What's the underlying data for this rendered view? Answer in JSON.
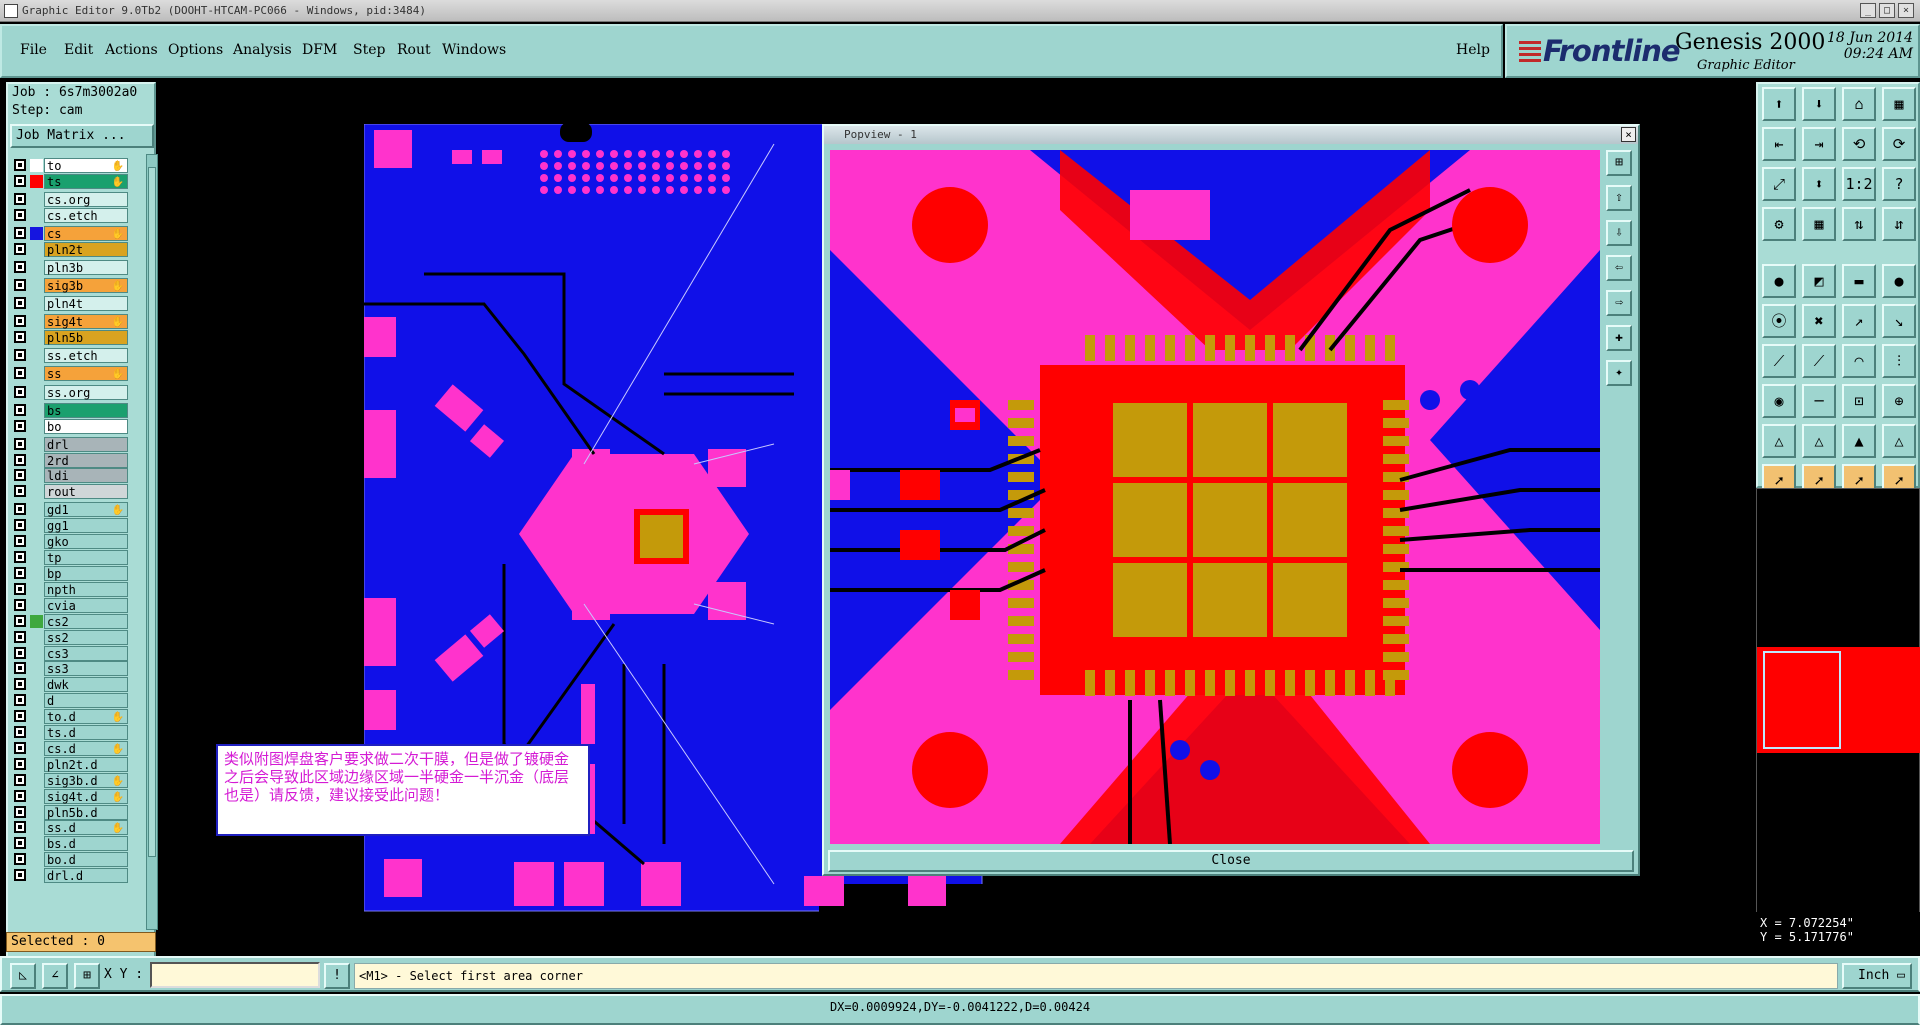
{
  "window": {
    "title": "Graphic Editor 9.0Tb2 (DOOHT-HTCAM-PC066 - Windows, pid:3484)"
  },
  "menu": {
    "items": [
      "File",
      "Edit",
      "Actions",
      "Options",
      "Analysis",
      "DFM",
      "Step",
      "Rout",
      "Windows"
    ],
    "help": "Help"
  },
  "brand": {
    "logo": "Frontline",
    "product": "Genesis 2000",
    "subtitle": "Graphic Editor",
    "date": "18 Jun 2014",
    "time": "09:24 AM"
  },
  "job": {
    "name": "Job : 6s7m3002a0",
    "step": "Step: cam",
    "matrix_button": "Job Matrix ..."
  },
  "layers": [
    {
      "name": "to",
      "bg": "#ffffff",
      "color": "#ffffff",
      "flag": "✋"
    },
    {
      "name": "ts",
      "bg": "#1aa06e",
      "color": "#ff0000",
      "flag": "✋"
    },
    {
      "name": "cs.org",
      "bg": "#d4f0ec",
      "color": ""
    },
    {
      "name": "cs.etch",
      "bg": "#d4f0ec",
      "color": ""
    },
    {
      "name": "cs",
      "bg": "#f5a23a",
      "color": "#1515e0",
      "flag": "✋"
    },
    {
      "name": "pln2t",
      "bg": "#d9a320",
      "color": ""
    },
    {
      "name": "pln3b",
      "bg": "#d4f0ec",
      "color": ""
    },
    {
      "name": "sig3b",
      "bg": "#f5a23a",
      "color": "",
      "flag": "✋"
    },
    {
      "name": "pln4t",
      "bg": "#d4f0ec",
      "color": ""
    },
    {
      "name": "sig4t",
      "bg": "#f5a23a",
      "color": "",
      "flag": "✋"
    },
    {
      "name": "pln5b",
      "bg": "#d9a320",
      "color": ""
    },
    {
      "name": "ss.etch",
      "bg": "#d4f0ec",
      "color": ""
    },
    {
      "name": "ss",
      "bg": "#f5a23a",
      "color": "",
      "flag": "✋"
    },
    {
      "name": "ss.org",
      "bg": "#d4f0ec",
      "color": ""
    },
    {
      "name": "bs",
      "bg": "#1aa06e",
      "color": ""
    },
    {
      "name": "bo",
      "bg": "#ffffff",
      "color": ""
    },
    {
      "name": "drl",
      "bg": "#a8b4b8",
      "color": ""
    },
    {
      "name": "2rd",
      "bg": "#a8b4b8",
      "color": ""
    },
    {
      "name": "ldi",
      "bg": "#a8b4b8",
      "color": ""
    },
    {
      "name": "rout",
      "bg": "#d0d6d8",
      "color": ""
    },
    {
      "name": "gd1",
      "bg": "#9ed5cf",
      "color": "",
      "flag": "✋"
    },
    {
      "name": "gg1",
      "bg": "#9ed5cf",
      "color": ""
    },
    {
      "name": "gko",
      "bg": "#9ed5cf",
      "color": ""
    },
    {
      "name": "tp",
      "bg": "#9ed5cf",
      "color": ""
    },
    {
      "name": "bp",
      "bg": "#9ed5cf",
      "color": ""
    },
    {
      "name": "npth",
      "bg": "#9ed5cf",
      "color": ""
    },
    {
      "name": "cvia",
      "bg": "#9ed5cf",
      "color": ""
    },
    {
      "name": "cs2",
      "bg": "#9ed5cf",
      "color": "#3ea83e"
    },
    {
      "name": "ss2",
      "bg": "#9ed5cf",
      "color": ""
    },
    {
      "name": "cs3",
      "bg": "#9ed5cf",
      "color": ""
    },
    {
      "name": "ss3",
      "bg": "#9ed5cf",
      "color": ""
    },
    {
      "name": "dwk",
      "bg": "#9ed5cf",
      "color": ""
    },
    {
      "name": "d",
      "bg": "#9ed5cf",
      "color": ""
    },
    {
      "name": "to.d",
      "bg": "#9ed5cf",
      "color": "",
      "flag": "✋"
    },
    {
      "name": "ts.d",
      "bg": "#9ed5cf",
      "color": ""
    },
    {
      "name": "cs.d",
      "bg": "#9ed5cf",
      "color": "",
      "flag": "✋"
    },
    {
      "name": "pln2t.d",
      "bg": "#9ed5cf",
      "color": ""
    },
    {
      "name": "sig3b.d",
      "bg": "#9ed5cf",
      "color": "",
      "flag": "✋"
    },
    {
      "name": "sig4t.d",
      "bg": "#9ed5cf",
      "color": "",
      "flag": "✋"
    },
    {
      "name": "pln5b.d",
      "bg": "#9ed5cf",
      "color": ""
    },
    {
      "name": "ss.d",
      "bg": "#9ed5cf",
      "color": "",
      "flag": "✋"
    },
    {
      "name": "bs.d",
      "bg": "#9ed5cf",
      "color": ""
    },
    {
      "name": "bo.d",
      "bg": "#9ed5cf",
      "color": ""
    },
    {
      "name": "drl.d",
      "bg": "#9ed5cf",
      "color": ""
    }
  ],
  "selected": "Selected : 0",
  "popview": {
    "title": "Popview - 1",
    "close_label": "Close"
  },
  "note": "类似附图焊盘客户要求做二次干膜，但是做了镀硬金之后会导致此区域边缘区域一半硬金一半沉金（底层也是）请反馈，建议接受此问题！",
  "coords": {
    "x": "X = 7.072254\"",
    "y": "Y = 5.171776\""
  },
  "bottom": {
    "xy_label": "X Y :",
    "xy_value": "",
    "message": "<M1> - Select first area corner",
    "unit": "Inch"
  },
  "status": "DX=0.0009924,DY=-0.0041222,D=0.00424",
  "colors": {
    "panel": "#9ed5cf",
    "board_blue": "#1010e8",
    "copper_red": "#ff0000",
    "pad_magenta": "#ff33cc",
    "gold": "#c49a0a"
  }
}
